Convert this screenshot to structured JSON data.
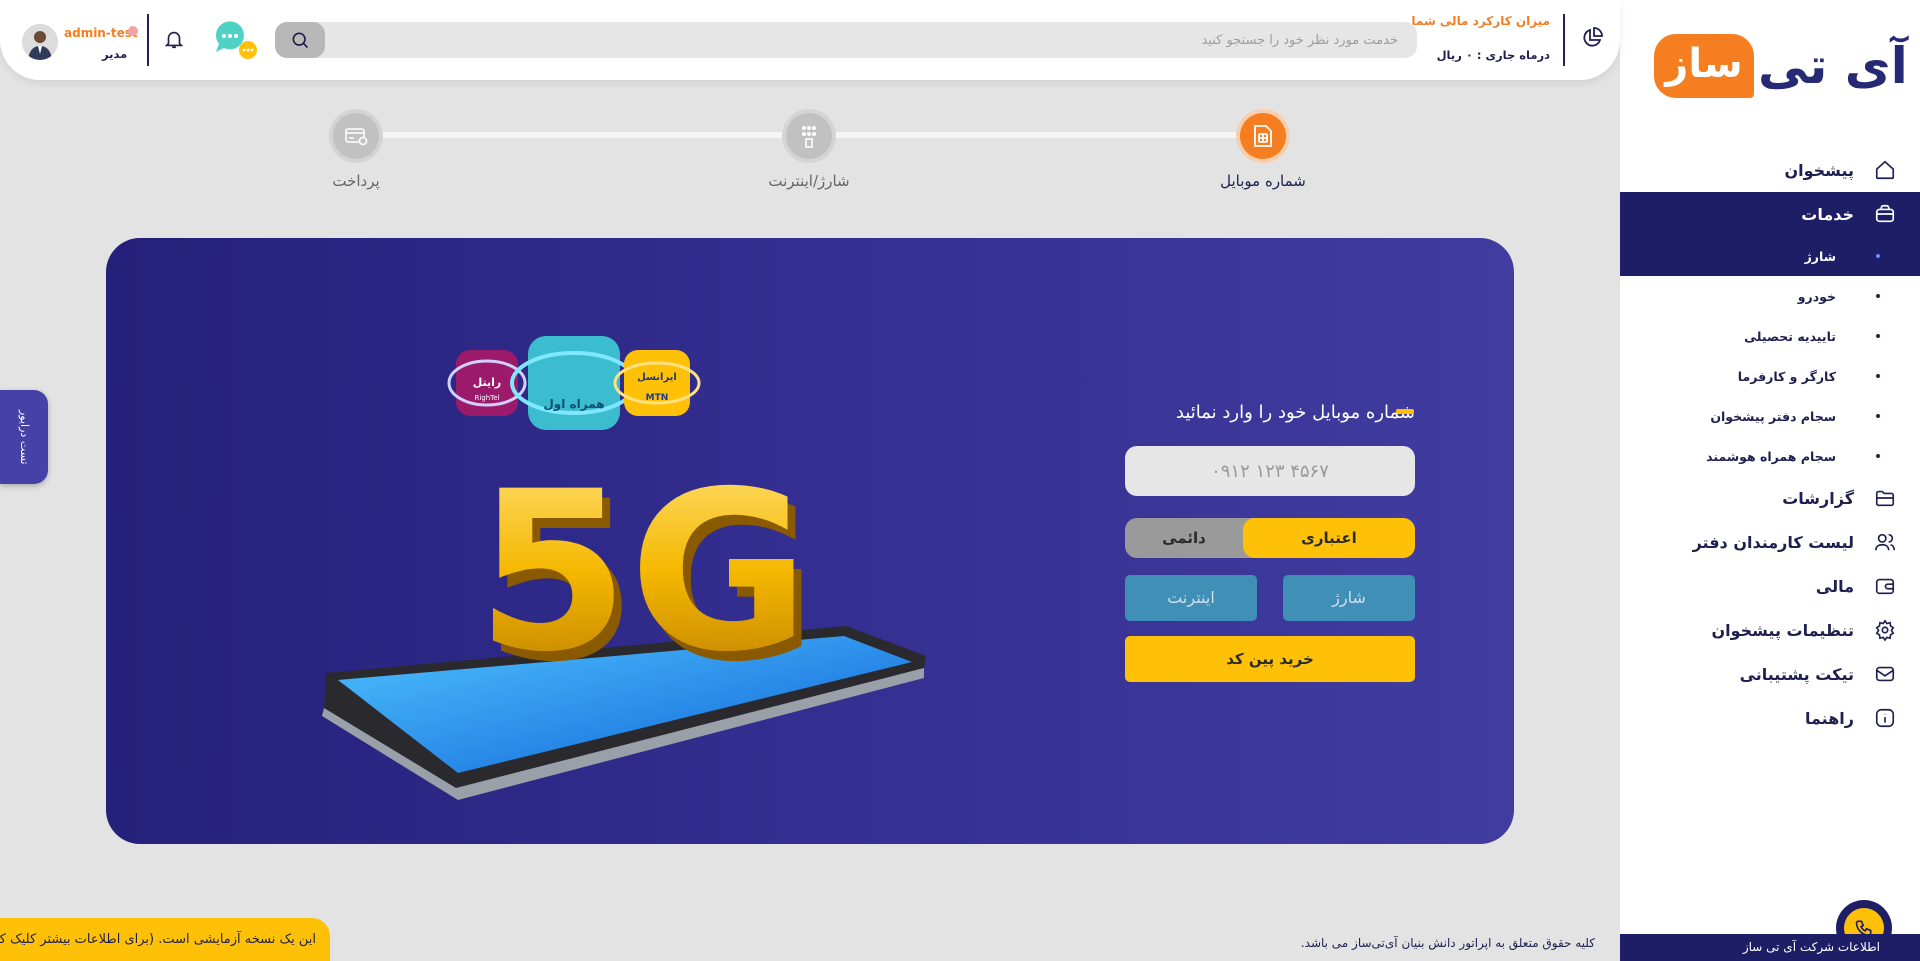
{
  "sidebar": {
    "logo": {
      "highlight": "ساز",
      "text": "آی تی"
    },
    "nav": [
      {
        "label": "پیشخوان",
        "icon": "home-icon"
      },
      {
        "label": "خدمات",
        "icon": "briefcase-icon",
        "active": true
      },
      {
        "label": "گزارشات",
        "icon": "folder-icon"
      },
      {
        "label": "لیست کارمندان دفتر",
        "icon": "users-icon"
      },
      {
        "label": "مالی",
        "icon": "wallet-icon"
      },
      {
        "label": "تنظیمات پیشخوان",
        "icon": "gear-icon"
      },
      {
        "label": "تیکت پشتیبانی",
        "icon": "mail-icon"
      },
      {
        "label": "راهنما",
        "icon": "info-icon"
      }
    ],
    "services_sub": [
      {
        "label": "شارژ",
        "active": true
      },
      {
        "label": "خودرو"
      },
      {
        "label": "تاییدیه تحصیلی"
      },
      {
        "label": "کارگر و کارفرما"
      },
      {
        "label": "سجام دفتر پیشخوان"
      },
      {
        "label": "سجام همراه هوشمند"
      }
    ],
    "footer": "اطلاعات شرکت آی تی ساز"
  },
  "header": {
    "finance_title": "میزان کارکرد مالی شما",
    "finance_sub": "درماه جاری : ۰ ریال",
    "search_placeholder": "خدمت مورد نظر خود را جستجو کنید",
    "user_name": "admin-test",
    "user_role": "مدیر"
  },
  "steps": [
    {
      "label": "شماره موبایل",
      "status": "done"
    },
    {
      "label": "شارژ/اینترنت",
      "status": "todo"
    },
    {
      "label": "پرداخت",
      "status": "todo"
    }
  ],
  "form": {
    "title": "شماره موبایل خود را وارد نمائید",
    "mobile_placeholder": "۰۹۱۲ ۱۲۳ ۴۵۶۷",
    "sim_prepaid": "اعتباری",
    "sim_postpaid": "دائمی",
    "type_charge": "شارژ",
    "type_internet": "اینترنت",
    "buy_pin": "خرید پین کد"
  },
  "promo": {
    "badge_5g": "5G",
    "operators": [
      "رایتل",
      "همراه اول",
      "ایرانسل"
    ],
    "rightel_sub": "RighTel",
    "mtn_sub": "MTN"
  },
  "misc": {
    "test_tab": "تست درایور",
    "copyright": "کلیه حقوق متعلق به اپراتور دانش بنیان آی‌تی‌ساز می باشد.",
    "trial_banner": "این یک نسخه آزمایشی است. (برای اطلاعات بیشتر کلیک کنید)"
  },
  "colors": {
    "primary_navy": "#1e1e67",
    "accent_orange": "#f57e20",
    "accent_yellow": "#ffc107",
    "button_blue": "#3f8fb6"
  }
}
